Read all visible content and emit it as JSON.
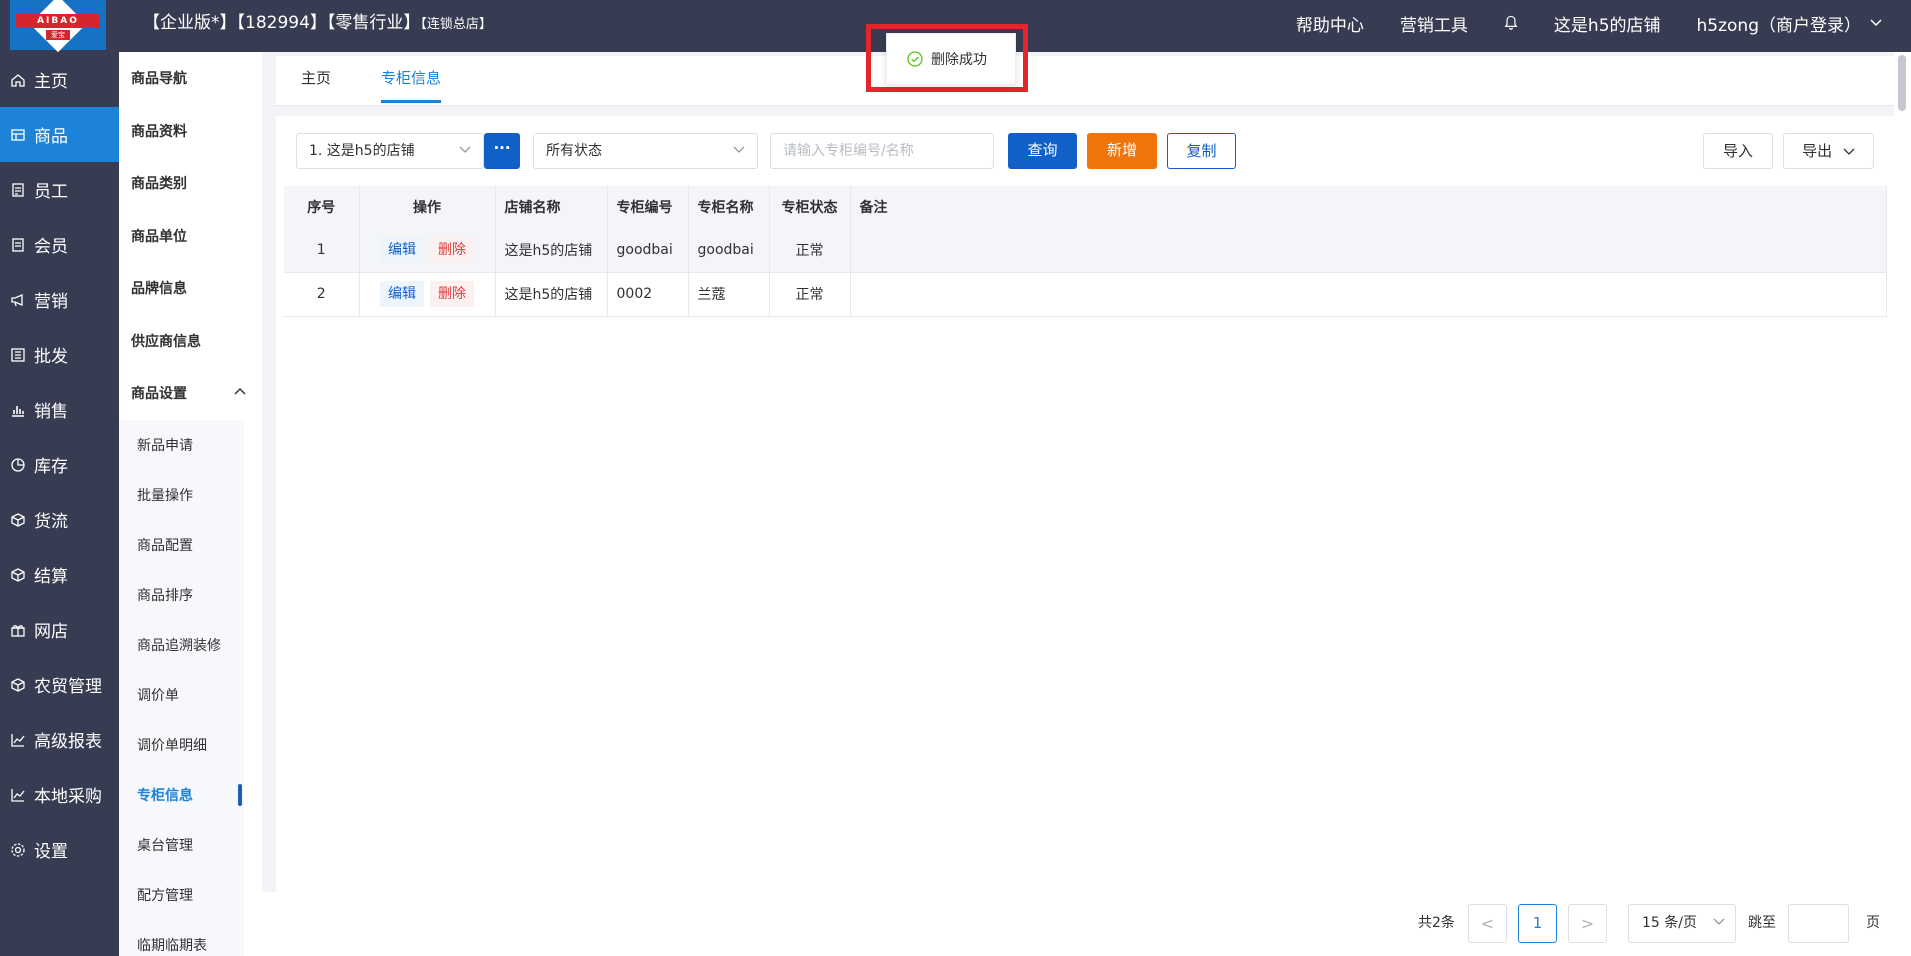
{
  "header": {
    "logo_text": "AIBAO",
    "logo_sub": "爱宝",
    "title_main": "【企业版*】【182994】【零售行业】",
    "title_small": "【连锁总店】",
    "help_center": "帮助中心",
    "marketing_tools": "营销工具",
    "store_name": "这是h5的店铺",
    "user": "h5zong（商户登录）"
  },
  "leftnav": [
    {
      "label": "主页",
      "icon": "home-icon",
      "active": false
    },
    {
      "label": "商品",
      "icon": "goods-icon",
      "active": true
    },
    {
      "label": "员工",
      "icon": "staff-icon",
      "active": false
    },
    {
      "label": "会员",
      "icon": "member-icon",
      "active": false
    },
    {
      "label": "营销",
      "icon": "megaphone-icon",
      "active": false
    },
    {
      "label": "批发",
      "icon": "wholesale-icon",
      "active": false
    },
    {
      "label": "销售",
      "icon": "bar-chart-icon",
      "active": false
    },
    {
      "label": "库存",
      "icon": "pie-chart-icon",
      "active": false
    },
    {
      "label": "货流",
      "icon": "cube-icon",
      "active": false
    },
    {
      "label": "结算",
      "icon": "cube-icon",
      "active": false
    },
    {
      "label": "网店",
      "icon": "gift-icon",
      "active": false
    },
    {
      "label": "农贸管理",
      "icon": "cube-icon",
      "active": false
    },
    {
      "label": "高级报表",
      "icon": "line-chart-icon",
      "active": false
    },
    {
      "label": "本地采购",
      "icon": "line-chart-icon",
      "active": false
    },
    {
      "label": "设置",
      "icon": "gear-icon",
      "active": false
    }
  ],
  "subnav": {
    "groups": [
      "商品导航",
      "商品资料",
      "商品类别",
      "商品单位",
      "品牌信息",
      "供应商信息",
      "商品设置"
    ],
    "children": [
      "新品申请",
      "批量操作",
      "商品配置",
      "商品排序",
      "商品追溯装修",
      "调价单",
      "调价单明细",
      "专柜信息",
      "桌台管理",
      "配方管理",
      "临期临期表"
    ]
  },
  "tabs": [
    "主页",
    "专柜信息"
  ],
  "toolbar": {
    "store_select": "1. 这是h5的店铺",
    "more": "···",
    "status_select": "所有状态",
    "search_placeholder": "请输入专柜编号/名称",
    "query": "查询",
    "add": "新增",
    "copy": "复制",
    "import": "导入",
    "export": "导出"
  },
  "table": {
    "headers": [
      "序号",
      "操作",
      "店铺名称",
      "专柜编号",
      "专柜名称",
      "专柜状态",
      "备注"
    ],
    "edit_label": "编辑",
    "delete_label": "删除",
    "rows": [
      {
        "no": "1",
        "store": "这是h5的店铺",
        "code": "goodbai",
        "name": "goodbai",
        "status": "正常",
        "remark": ""
      },
      {
        "no": "2",
        "store": "这是h5的店铺",
        "code": "0002",
        "name": "兰蔻",
        "status": "正常",
        "remark": ""
      }
    ]
  },
  "pagination": {
    "total": "共2条",
    "prev": "<",
    "current": "1",
    "next": ">",
    "page_size": "15 条/页",
    "jump": "跳至",
    "page": "页"
  },
  "toast": {
    "message": "删除成功",
    "color": "#e4262a"
  }
}
